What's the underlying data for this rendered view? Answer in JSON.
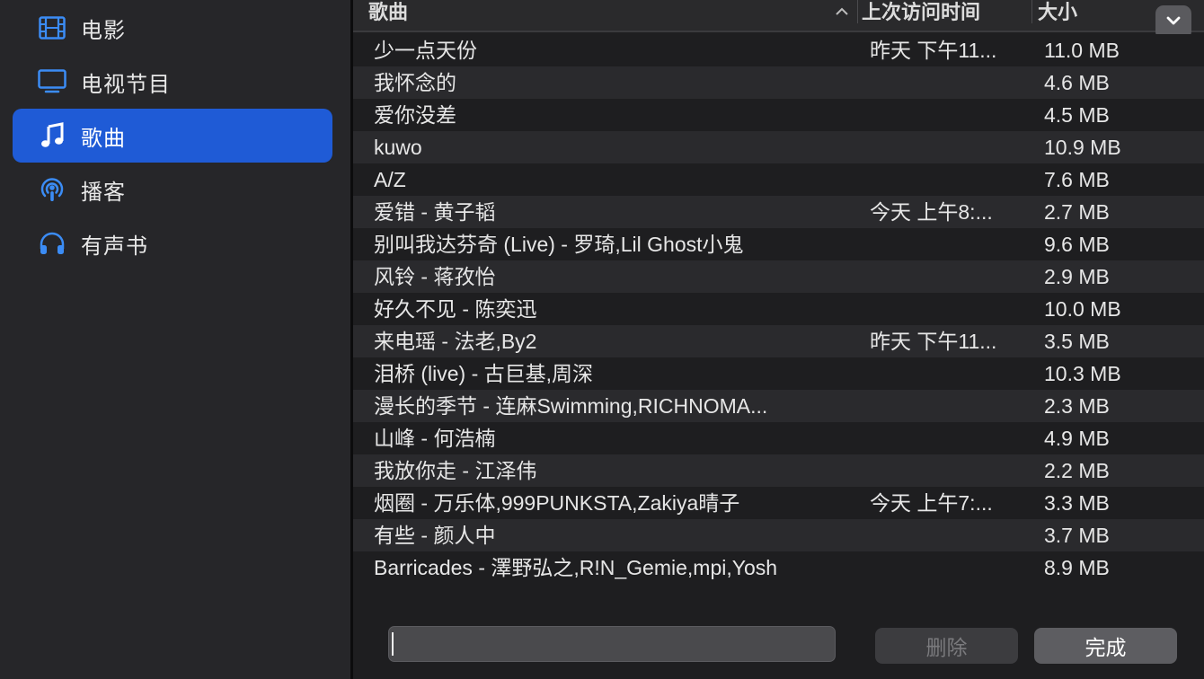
{
  "sidebar": {
    "items": [
      {
        "label": "电影",
        "icon": "film-icon"
      },
      {
        "label": "电视节目",
        "icon": "tv-icon"
      },
      {
        "label": "歌曲",
        "icon": "music-note-icon",
        "selected": true
      },
      {
        "label": "播客",
        "icon": "podcast-icon"
      },
      {
        "label": "有声书",
        "icon": "headphones-icon"
      }
    ]
  },
  "table": {
    "columns": {
      "name": "歌曲",
      "last_accessed": "上次访问时间",
      "size": "大小"
    },
    "rows": [
      {
        "name": "少一点天份",
        "time": "昨天 下午11...",
        "size": "11.0 MB"
      },
      {
        "name": "我怀念的",
        "time": "",
        "size": "4.6 MB"
      },
      {
        "name": "爱你没差",
        "time": "",
        "size": "4.5 MB"
      },
      {
        "name": "kuwo",
        "time": "",
        "size": "10.9 MB"
      },
      {
        "name": "A/Z",
        "time": "",
        "size": "7.6 MB"
      },
      {
        "name": "爱错 - 黄子韬",
        "time": "今天 上午8:...",
        "size": "2.7 MB"
      },
      {
        "name": "别叫我达芬奇 (Live) - 罗琦,Lil Ghost小鬼",
        "time": "",
        "size": "9.6 MB"
      },
      {
        "name": "风铃 - 蒋孜怡",
        "time": "",
        "size": "2.9 MB"
      },
      {
        "name": "好久不见 - 陈奕迅",
        "time": "",
        "size": "10.0 MB"
      },
      {
        "name": "来电瑶 - 法老,By2",
        "time": "昨天 下午11...",
        "size": "3.5 MB"
      },
      {
        "name": "泪桥 (live) - 古巨基,周深",
        "time": "",
        "size": "10.3 MB"
      },
      {
        "name": "漫长的季节 - 连麻Swimming,RICHNOMA...",
        "time": "",
        "size": "2.3 MB"
      },
      {
        "name": "山峰 - 何浩楠",
        "time": "",
        "size": "4.9 MB"
      },
      {
        "name": "我放你走 - 江泽伟",
        "time": "",
        "size": "2.2 MB"
      },
      {
        "name": "烟圈 - 万乐体,999PUNKSTA,Zakiya晴子",
        "time": "今天 上午7:...",
        "size": "3.3 MB"
      },
      {
        "name": "有些 - 颜人中",
        "time": "",
        "size": "3.7 MB"
      },
      {
        "name": "Barricades - 澤野弘之,R!N_Gemie,mpi,Yosh",
        "time": "",
        "size": "8.9 MB"
      }
    ]
  },
  "footer": {
    "search_value": "",
    "delete_label": "删除",
    "done_label": "完成"
  },
  "colors": {
    "accent": "#1f5bd6",
    "icon_blue": "#3b8cf5",
    "background": "#1e1e20"
  }
}
